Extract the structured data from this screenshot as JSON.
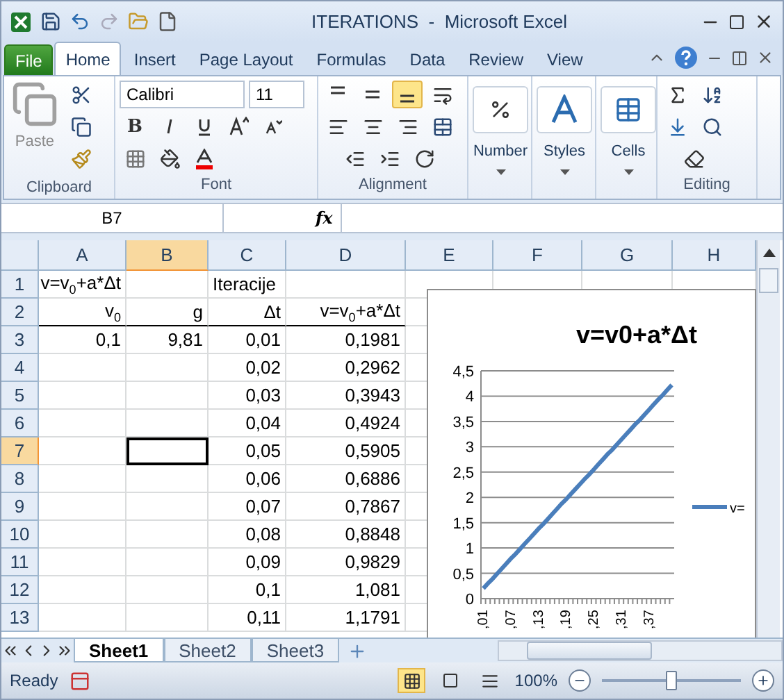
{
  "title_bar": {
    "title": "ITERATIONS  -  Microsoft Excel"
  },
  "ribbon_tabs": [
    {
      "label": "File",
      "kind": "file",
      "selected": false
    },
    {
      "label": "Home",
      "kind": "tab",
      "selected": true
    },
    {
      "label": "Insert",
      "kind": "tab",
      "selected": false
    },
    {
      "label": "Page Layout",
      "kind": "tab",
      "selected": false
    },
    {
      "label": "Formulas",
      "kind": "tab",
      "selected": false
    },
    {
      "label": "Data",
      "kind": "tab",
      "selected": false
    },
    {
      "label": "Review",
      "kind": "tab",
      "selected": false
    },
    {
      "label": "View",
      "kind": "tab",
      "selected": false
    }
  ],
  "ribbon_groups": [
    {
      "kind": "clipboard",
      "label": "Clipboard",
      "button": "Paste"
    },
    {
      "kind": "font",
      "label": "Font",
      "font_name": "Calibri",
      "font_size": "11",
      "bold": "B"
    },
    {
      "kind": "alignment",
      "label": "Alignment",
      "vertical_align": [
        {
          "selected": false
        },
        {
          "selected": false
        },
        {
          "selected": true
        }
      ]
    },
    {
      "kind": "big",
      "button": "Number"
    },
    {
      "kind": "big",
      "button": "Styles"
    },
    {
      "kind": "big",
      "button": "Cells"
    },
    {
      "kind": "editing",
      "label": "Editing"
    }
  ],
  "formula_bar": {
    "name_box": "B7",
    "function_label": "fx"
  },
  "columns": [
    {
      "label": "A",
      "selected": false
    },
    {
      "label": "B",
      "selected": true
    },
    {
      "label": "C",
      "selected": false
    },
    {
      "label": "D",
      "selected": false
    },
    {
      "label": "E",
      "selected": false
    },
    {
      "label": "F",
      "selected": false
    },
    {
      "label": "G",
      "selected": false
    },
    {
      "label": "H",
      "selected": false
    }
  ],
  "rows": [
    {
      "label": "1",
      "selected": false,
      "cells": {
        "A": "v=v$_{0}$+a*Δt",
        "C": "Iteracije"
      }
    },
    {
      "label": "2",
      "selected": false,
      "cells": {
        "A": "v$_{0}$",
        "B": "g",
        "C": "Δt",
        "D": "v=v$_{0}$+a*Δt"
      }
    },
    {
      "label": "3",
      "selected": false,
      "cells": {
        "A": "0,1",
        "B": "9,81",
        "C": "0,01",
        "D": "0,1981"
      }
    },
    {
      "label": "4",
      "selected": false,
      "cells": {
        "C": "0,02",
        "D": "0,2962"
      }
    },
    {
      "label": "5",
      "selected": false,
      "cells": {
        "C": "0,03",
        "D": "0,3943"
      }
    },
    {
      "label": "6",
      "selected": false,
      "cells": {
        "C": "0,04",
        "D": "0,4924"
      }
    },
    {
      "label": "7",
      "selected": true,
      "cells": {
        "C": "0,05",
        "D": "0,5905"
      }
    },
    {
      "label": "8",
      "selected": false,
      "cells": {
        "C": "0,06",
        "D": "0,6886"
      }
    },
    {
      "label": "9",
      "selected": false,
      "cells": {
        "C": "0,07",
        "D": "0,7867"
      }
    },
    {
      "label": "10",
      "selected": false,
      "cells": {
        "C": "0,08",
        "D": "0,8848"
      }
    },
    {
      "label": "11",
      "selected": false,
      "cells": {
        "C": "0,09",
        "D": "0,9829"
      }
    },
    {
      "label": "12",
      "selected": false,
      "cells": {
        "C": "0,1",
        "D": "1,081"
      }
    },
    {
      "label": "13",
      "selected": false,
      "cells": {
        "C": "0,11",
        "D": "1,1791"
      }
    }
  ],
  "chart": {
    "chart_data": {
      "type": "line",
      "title": "v=v0+a*Δt",
      "categories": [
        ",01",
        null,
        null,
        null,
        null,
        null,
        ",07",
        null,
        null,
        null,
        null,
        null,
        ",13",
        null,
        null,
        null,
        null,
        null,
        ",19",
        null,
        null,
        null,
        null,
        null,
        ",25",
        null,
        null,
        null,
        null,
        null,
        ",31",
        null,
        null,
        null,
        null,
        null,
        ",37",
        null,
        null,
        null,
        null,
        null
      ],
      "series": [
        {
          "name": "v=",
          "color": "#4a7ebb",
          "values": [
            0.2,
            0.3,
            0.39,
            0.49,
            0.59,
            0.69,
            0.79,
            0.88,
            0.98,
            1.08,
            1.18,
            1.28,
            1.38,
            1.47,
            1.57,
            1.67,
            1.77,
            1.87,
            1.96,
            2.06,
            2.16,
            2.26,
            2.36,
            2.45,
            2.55,
            2.65,
            2.75,
            2.85,
            2.94,
            3.04,
            3.14,
            3.24,
            3.34,
            3.44,
            3.53,
            3.63,
            3.73,
            3.83,
            3.93,
            4.02,
            4.12,
            4.22
          ]
        }
      ],
      "ylim": [
        0,
        4.5
      ],
      "grid": true,
      "yticks": [
        {
          "value": 0,
          "label": "0"
        },
        {
          "value": 0.5,
          "label": "0,5"
        },
        {
          "value": 1,
          "label": "1"
        },
        {
          "value": 1.5,
          "label": "1,5"
        },
        {
          "value": 2,
          "label": "2"
        },
        {
          "value": 2.5,
          "label": "2,5"
        },
        {
          "value": 3,
          "label": "3"
        },
        {
          "value": 3.5,
          "label": "3,5"
        },
        {
          "value": 4,
          "label": "4"
        },
        {
          "value": 4.5,
          "label": "4,5"
        }
      ]
    }
  },
  "sheet_tabs": [
    {
      "label": "Sheet1",
      "selected": true
    },
    {
      "label": "Sheet2",
      "selected": false
    },
    {
      "label": "Sheet3",
      "selected": false
    }
  ],
  "status_bar": {
    "status": "Ready",
    "views": [
      {
        "kind": "normal",
        "selected": true
      },
      {
        "kind": "page_layout",
        "selected": false
      },
      {
        "kind": "page_break",
        "selected": false
      }
    ],
    "zoom": "100%",
    "zoom_slider": {
      "level": 0.5
    }
  }
}
